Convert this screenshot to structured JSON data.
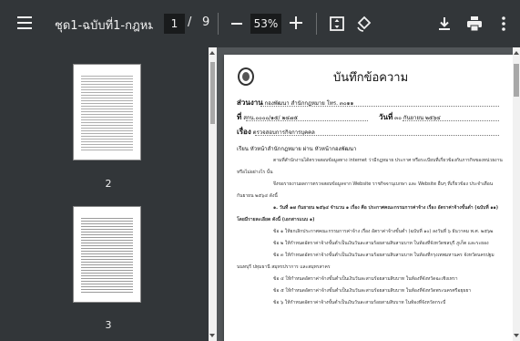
{
  "toolbar": {
    "title": "ชุด1-ฉบับที่1-กฎหมา...",
    "current_page": "1",
    "page_separator": "/",
    "total_pages": "9",
    "zoom": "53%",
    "icons": [
      "menu-icon",
      "zoom-out-icon",
      "zoom-in-icon",
      "fit-page-icon",
      "rotate-icon",
      "download-icon",
      "print-icon",
      "more-vert-icon"
    ]
  },
  "sidebar": {
    "thumbnails": [
      {
        "label": "2"
      },
      {
        "label": "3"
      }
    ]
  },
  "document": {
    "heading": "บันทึกข้อความ",
    "fields": {
      "dept_label": "ส่วนงาน",
      "dept_value": "กองพัฒนา สำนักกฎหมาย   โทร. ๓๐๑๑",
      "ref_label": "ที่",
      "ref_value": "สกน.๐๐๐๐/๑๕/ ๒๔๗๕",
      "date_label": "วันที่",
      "date_value": "๓๐  กันยายน  ๒๕๖๔",
      "subject_label": "เรื่อง",
      "subject_value": "ตรวจสอบการกิจการบุคคล"
    },
    "to_line": "เรียน   หัวหน้าสำนักกฎหมาย ผ่าน หัวหน้ากองพัฒนา",
    "paragraphs": [
      "ตามที่สำนักงานได้ตรวจสอบข้อมูลทาง internet ว่ามีกฎหมาย ประกาศ หรือระเบียบที่เกี่ยวข้องกับภารกิจของหน่วยงาน หรือไม่อย่างไร นั้น",
      "จึงขอรายงานผลการตรวจสอบข้อมูลจาก Website ราชกิจจานุเบกษา และ Website อื่นๆ ที่เกี่ยวข้อง ประจำเดือน กันยายน ๒๕๖๔ ดังนี้",
      "๑. วันที่ ๑๗ กันยายน ๒๕๖๔ จำนวน ๑ เรื่อง คือ ประกาศคณะกรรมการค่าจ้าง เรื่อง อัตราค่าจ้างขั้นต่ำ (ฉบับที่ ๑๑) โดยมีรายละเอียด ดังนี้ (เอกสารแนบ ๑)",
      "ข้อ ๑ ให้ยกเลิกประกาศคณะกรรมการค่าจ้าง เรื่อง อัตราค่าจ้างขั้นต่ำ (ฉบับที่ ๑๐) ลงวันที่ ๖ ธันวาคม พ.ศ. ๒๕๖๒",
      "ข้อ ๒ ให้กำหนดอัตราค่าจ้างขั้นต่ำเป็นเงินวันละสามร้อยสามสิบสามบาท ในท้องที่จังหวัดชลบุรี ภูเก็ต และระยอง",
      "ข้อ ๓ ให้กำหนดอัตราค่าจ้างขั้นต่ำเป็นเงินวันละสามร้อยสามสิบสามบาท ในท้องที่กรุงเทพมหานคร จังหวัดนครปฐม นนทบุรี ปทุมธานี สมุทรปราการ และสมุทรสาคร",
      "ข้อ ๔ ให้กำหนดอัตราค่าจ้างขั้นต่ำเป็นเงินวันละสามร้อยสามสิบบาท ในท้องที่จังหวัดฉะเชิงเทรา",
      "ข้อ ๕ ให้กำหนดอัตราค่าจ้างขั้นต่ำเป็นเงินวันละสามร้อยสามสิบบาท ในท้องที่จังหวัดพระนครศรีอยุธยา",
      "ข้อ ๖ ให้กำหนดอัตราค่าจ้างขั้นต่ำเป็นเงินวันละสามร้อยสามสิบบาท ในท้องที่จังหวัดกระบี่"
    ]
  }
}
